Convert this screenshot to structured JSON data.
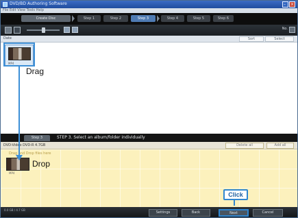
{
  "window": {
    "title": "DVD/BD Authoring Software",
    "menu": "File  Edit  View  Tools  Help"
  },
  "steps": [
    "Create Disc",
    "Step 1",
    "Step 2",
    "Step 3",
    "Step 4",
    "Step 5",
    "Step 6"
  ],
  "toolbar": {
    "right_label": "No."
  },
  "library": {
    "header": "Date",
    "btn_a": "Sort",
    "btn_b": "Select",
    "thumb_caption": "MP4",
    "drag_label": "Drag"
  },
  "middle": {
    "tab": "Step 3",
    "message": "STEP 3. Select an album/folder individually"
  },
  "disc": {
    "header": "DVD-Video DVD-R 4.7GB",
    "btn_a": "Delete all",
    "btn_b": "Add all",
    "hint": "Drag and Drop files here",
    "thumb_caption": "MP4",
    "drop_label": "Drop"
  },
  "callout": {
    "label": "Click"
  },
  "bottom": {
    "info": "0.0 GB / 4.7 GB",
    "buttons": [
      "Settings",
      "Back",
      "Next",
      "Cancel"
    ]
  }
}
